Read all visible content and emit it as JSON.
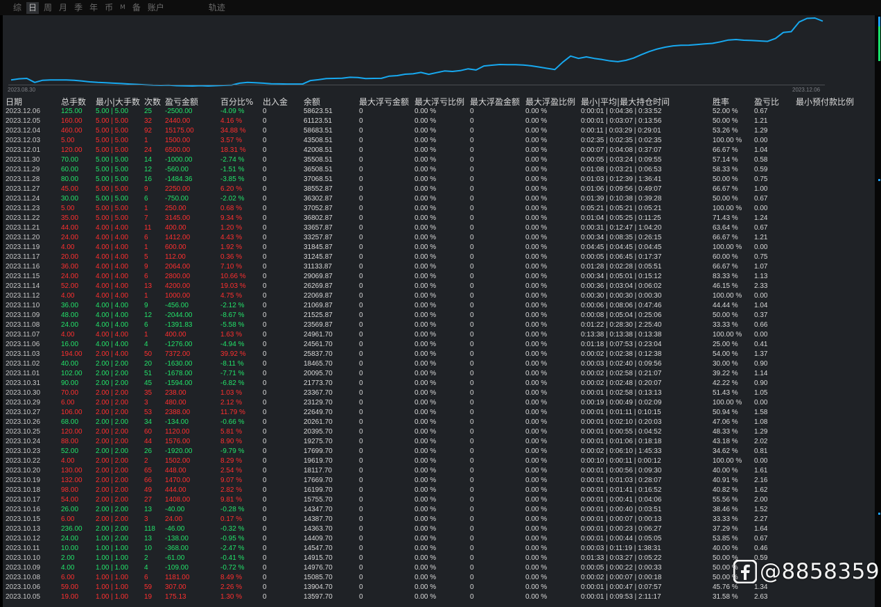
{
  "tabs": [
    {
      "label": "综",
      "active": false
    },
    {
      "label": "日",
      "active": true
    },
    {
      "label": "周",
      "active": false
    },
    {
      "label": "月",
      "active": false
    },
    {
      "label": "季",
      "active": false
    },
    {
      "label": "年",
      "active": false
    },
    {
      "label": "币",
      "active": false
    },
    {
      "label": "M",
      "active": false
    },
    {
      "label": "备",
      "active": false
    },
    {
      "label": "账户",
      "active": false
    },
    {
      "label": "轨迹",
      "active": false
    }
  ],
  "chart": {
    "start_label": "2023.08.30",
    "end_label": "2023.12.06",
    "line_color": "#17a9f0",
    "series": [
      13500,
      14150,
      14400,
      12000,
      13300,
      13500,
      13500,
      13500,
      13300,
      12800,
      12300,
      12000,
      11800,
      11500,
      11300,
      11000,
      10800,
      10500,
      10300,
      10200,
      10300,
      10000,
      9900,
      9800,
      10000,
      9800,
      10000,
      10200,
      10400,
      11500,
      12000,
      11800,
      11500,
      11200,
      11100,
      11000,
      11000,
      11000,
      13100,
      13600,
      14300,
      14400,
      14550,
      15100,
      14900,
      14350,
      14400,
      14450,
      15800,
      16100,
      16950,
      17200,
      18000,
      16900,
      17900,
      18900,
      18600,
      19100,
      20200,
      19500,
      21900,
      22400,
      22800,
      22700,
      22700,
      22500,
      22000,
      21300,
      20500,
      19800,
      24200,
      27900,
      26500,
      27400,
      26500,
      25800,
      25000,
      24500,
      25300,
      26700,
      28800,
      30700,
      32200,
      33300,
      34100,
      34400,
      34500,
      34900,
      35300,
      35600,
      36500,
      37600,
      37900,
      37500,
      37300,
      37050,
      36800,
      38550,
      42200,
      42700,
      48500,
      50700,
      50900,
      49000
    ]
  },
  "headers": {
    "date": "日期",
    "total": "总手数",
    "minmax": "最小|大手数",
    "count": "次数",
    "pl": "盈亏金额",
    "pct": "百分比%",
    "io": "出入金",
    "balance": "余额",
    "fl_amt": "最大浮亏金额",
    "fl_ratio": "最大浮亏比例",
    "fp_amt": "最大浮盈金额",
    "fp_ratio": "最大浮盈比例",
    "hold": "最小|平均|最大持仓时间",
    "win": "胜率",
    "ratio": "盈亏比",
    "min_prepay": "最小预付款比例"
  },
  "rows": [
    [
      "2023.12.06",
      "125.00",
      "5.00 | 5.00",
      "25",
      "-2500.00",
      "-4.09 %",
      "0",
      "58623.51",
      "0",
      "0.00 %",
      "0",
      "0.00 %",
      "0:00:01 | 0:04:36 | 0:33:52",
      "52.00 %",
      "0.67"
    ],
    [
      "2023.12.05",
      "160.00",
      "5.00 | 5.00",
      "32",
      "2440.00",
      "4.16 %",
      "0",
      "61123.51",
      "0",
      "0.00 %",
      "0",
      "0.00 %",
      "0:00:01 | 0:03:07 | 0:13:56",
      "50.00 %",
      "1.21"
    ],
    [
      "2023.12.04",
      "460.00",
      "5.00 | 5.00",
      "92",
      "15175.00",
      "34.88 %",
      "0",
      "58683.51",
      "0",
      "0.00 %",
      "0",
      "0.00 %",
      "0:00:11 | 0:03:29 | 0:29:01",
      "53.26 %",
      "1.29"
    ],
    [
      "2023.12.03",
      "5.00",
      "5.00 | 5.00",
      "1",
      "1500.00",
      "3.57 %",
      "0",
      "43508.51",
      "0",
      "0.00 %",
      "0",
      "0.00 %",
      "0:02:35 | 0:02:35 | 0:02:35",
      "100.00 %",
      "0.00"
    ],
    [
      "2023.12.01",
      "120.00",
      "5.00 | 5.00",
      "24",
      "6500.00",
      "18.31 %",
      "0",
      "42008.51",
      "0",
      "0.00 %",
      "0",
      "0.00 %",
      "0:00:07 | 0:04:08 | 0:37:07",
      "66.67 %",
      "1.04"
    ],
    [
      "2023.11.30",
      "70.00",
      "5.00 | 5.00",
      "14",
      "-1000.00",
      "-2.74 %",
      "0",
      "35508.51",
      "0",
      "0.00 %",
      "0",
      "0.00 %",
      "0:00:05 | 0:03:24 | 0:09:55",
      "57.14 %",
      "0.58"
    ],
    [
      "2023.11.29",
      "60.00",
      "5.00 | 5.00",
      "12",
      "-560.00",
      "-1.51 %",
      "0",
      "36508.51",
      "0",
      "0.00 %",
      "0",
      "0.00 %",
      "0:01:08 | 0:03:21 | 0:06:53",
      "58.33 %",
      "0.59"
    ],
    [
      "2023.11.28",
      "80.00",
      "5.00 | 5.00",
      "16",
      "-1484.36",
      "-3.85 %",
      "0",
      "37068.51",
      "0",
      "0.00 %",
      "0",
      "0.00 %",
      "0:01:03 | 0:12:39 | 1:36:41",
      "50.00 %",
      "0.75"
    ],
    [
      "2023.11.27",
      "45.00",
      "5.00 | 5.00",
      "9",
      "2250.00",
      "6.20 %",
      "0",
      "38552.87",
      "0",
      "0.00 %",
      "0",
      "0.00 %",
      "0:01:06 | 0:09:56 | 0:49:07",
      "66.67 %",
      "1.00"
    ],
    [
      "2023.11.24",
      "30.00",
      "5.00 | 5.00",
      "6",
      "-750.00",
      "-2.02 %",
      "0",
      "36302.87",
      "0",
      "0.00 %",
      "0",
      "0.00 %",
      "0:01:39 | 0:10:38 | 0:39:28",
      "50.00 %",
      "0.67"
    ],
    [
      "2023.11.23",
      "5.00",
      "5.00 | 5.00",
      "1",
      "250.00",
      "0.68 %",
      "0",
      "37052.87",
      "0",
      "0.00 %",
      "0",
      "0.00 %",
      "0:05:21 | 0:05:21 | 0:05:21",
      "100.00 %",
      "0.00"
    ],
    [
      "2023.11.22",
      "35.00",
      "5.00 | 5.00",
      "7",
      "3145.00",
      "9.34 %",
      "0",
      "36802.87",
      "0",
      "0.00 %",
      "0",
      "0.00 %",
      "0:01:04 | 0:05:25 | 0:11:25",
      "71.43 %",
      "1.24"
    ],
    [
      "2023.11.21",
      "44.00",
      "4.00 | 4.00",
      "11",
      "400.00",
      "1.20 %",
      "0",
      "33657.87",
      "0",
      "0.00 %",
      "0",
      "0.00 %",
      "0:00:31 | 0:12:47 | 1:04:20",
      "63.64 %",
      "0.67"
    ],
    [
      "2023.11.20",
      "24.00",
      "4.00 | 4.00",
      "6",
      "1412.00",
      "4.43 %",
      "0",
      "33257.87",
      "0",
      "0.00 %",
      "0",
      "0.00 %",
      "0:00:34 | 0:08:35 | 0:26:15",
      "66.67 %",
      "1.21"
    ],
    [
      "2023.11.19",
      "4.00",
      "4.00 | 4.00",
      "1",
      "600.00",
      "1.92 %",
      "0",
      "31845.87",
      "0",
      "0.00 %",
      "0",
      "0.00 %",
      "0:04:45 | 0:04:45 | 0:04:45",
      "100.00 %",
      "0.00"
    ],
    [
      "2023.11.17",
      "20.00",
      "4.00 | 4.00",
      "5",
      "112.00",
      "0.36 %",
      "0",
      "31245.87",
      "0",
      "0.00 %",
      "0",
      "0.00 %",
      "0:00:05 | 0:06:45 | 0:17:37",
      "60.00 %",
      "0.75"
    ],
    [
      "2023.11.16",
      "36.00",
      "4.00 | 4.00",
      "9",
      "2064.00",
      "7.10 %",
      "0",
      "31133.87",
      "0",
      "0.00 %",
      "0",
      "0.00 %",
      "0:01:28 | 0:02:28 | 0:05:51",
      "66.67 %",
      "1.07"
    ],
    [
      "2023.11.15",
      "24.00",
      "4.00 | 4.00",
      "6",
      "2800.00",
      "10.66 %",
      "0",
      "29069.87",
      "0",
      "0.00 %",
      "0",
      "0.00 %",
      "0:00:34 | 0:05:01 | 0:15:12",
      "83.33 %",
      "1.13"
    ],
    [
      "2023.11.14",
      "52.00",
      "4.00 | 4.00",
      "13",
      "4200.00",
      "19.03 %",
      "0",
      "26269.87",
      "0",
      "0.00 %",
      "0",
      "0.00 %",
      "0:00:36 | 0:03:04 | 0:06:02",
      "46.15 %",
      "2.33"
    ],
    [
      "2023.11.12",
      "4.00",
      "4.00 | 4.00",
      "1",
      "1000.00",
      "4.75 %",
      "0",
      "22069.87",
      "0",
      "0.00 %",
      "0",
      "0.00 %",
      "0:00:30 | 0:00:30 | 0:00:30",
      "100.00 %",
      "0.00"
    ],
    [
      "2023.11.10",
      "36.00",
      "4.00 | 4.00",
      "9",
      "-456.00",
      "-2.12 %",
      "0",
      "21069.87",
      "0",
      "0.00 %",
      "0",
      "0.00 %",
      "0:00:06 | 0:08:06 | 0:47:46",
      "44.44 %",
      "1.04"
    ],
    [
      "2023.11.09",
      "48.00",
      "4.00 | 4.00",
      "12",
      "-2044.00",
      "-8.67 %",
      "0",
      "21525.87",
      "0",
      "0.00 %",
      "0",
      "0.00 %",
      "0:00:08 | 0:05:04 | 0:25:06",
      "50.00 %",
      "0.37"
    ],
    [
      "2023.11.08",
      "24.00",
      "4.00 | 4.00",
      "6",
      "-1391.83",
      "-5.58 %",
      "0",
      "23569.87",
      "0",
      "0.00 %",
      "0",
      "0.00 %",
      "0:01:22 | 0:28:30 | 2:25:40",
      "33.33 %",
      "0.66"
    ],
    [
      "2023.11.07",
      "4.00",
      "4.00 | 4.00",
      "1",
      "400.00",
      "1.63 %",
      "0",
      "24961.70",
      "0",
      "0.00 %",
      "0",
      "0.00 %",
      "0:13:38 | 0:13:38 | 0:13:38",
      "100.00 %",
      "0.00"
    ],
    [
      "2023.11.06",
      "16.00",
      "4.00 | 4.00",
      "4",
      "-1276.00",
      "-4.94 %",
      "0",
      "24561.70",
      "0",
      "0.00 %",
      "0",
      "0.00 %",
      "0:01:18 | 0:07:53 | 0:23:04",
      "25.00 %",
      "0.41"
    ],
    [
      "2023.11.03",
      "194.00",
      "2.00 | 4.00",
      "50",
      "7372.00",
      "39.92 %",
      "0",
      "25837.70",
      "0",
      "0.00 %",
      "0",
      "0.00 %",
      "0:00:02 | 0:02:38 | 0:12:38",
      "54.00 %",
      "1.37"
    ],
    [
      "2023.11.02",
      "40.00",
      "2.00 | 2.00",
      "20",
      "-1630.00",
      "-8.11 %",
      "0",
      "18465.70",
      "0",
      "0.00 %",
      "0",
      "0.00 %",
      "0:00:03 | 0:02:40 | 0:09:56",
      "30.00 %",
      "0.90"
    ],
    [
      "2023.11.01",
      "102.00",
      "2.00 | 2.00",
      "51",
      "-1678.00",
      "-7.71 %",
      "0",
      "20095.70",
      "0",
      "0.00 %",
      "0",
      "0.00 %",
      "0:00:02 | 0:02:58 | 0:21:07",
      "39.22 %",
      "1.14"
    ],
    [
      "2023.10.31",
      "90.00",
      "2.00 | 2.00",
      "45",
      "-1594.00",
      "-6.82 %",
      "0",
      "21773.70",
      "0",
      "0.00 %",
      "0",
      "0.00 %",
      "0:00:02 | 0:02:48 | 0:20:07",
      "42.22 %",
      "0.90"
    ],
    [
      "2023.10.30",
      "70.00",
      "2.00 | 2.00",
      "35",
      "238.00",
      "1.03 %",
      "0",
      "23367.70",
      "0",
      "0.00 %",
      "0",
      "0.00 %",
      "0:00:01 | 0:02:58 | 0:13:13",
      "51.43 %",
      "1.05"
    ],
    [
      "2023.10.29",
      "6.00",
      "2.00 | 2.00",
      "3",
      "480.00",
      "2.12 %",
      "0",
      "23129.70",
      "0",
      "0.00 %",
      "0",
      "0.00 %",
      "0:00:19 | 0:00:49 | 0:02:09",
      "100.00 %",
      "0.00"
    ],
    [
      "2023.10.27",
      "106.00",
      "2.00 | 2.00",
      "53",
      "2388.00",
      "11.79 %",
      "0",
      "22649.70",
      "0",
      "0.00 %",
      "0",
      "0.00 %",
      "0:00:01 | 0:01:11 | 0:10:15",
      "50.94 %",
      "1.58"
    ],
    [
      "2023.10.26",
      "68.00",
      "2.00 | 2.00",
      "34",
      "-134.00",
      "-0.66 %",
      "0",
      "20261.70",
      "0",
      "0.00 %",
      "0",
      "0.00 %",
      "0:00:01 | 0:02:10 | 0:20:03",
      "47.06 %",
      "1.08"
    ],
    [
      "2023.10.25",
      "120.00",
      "2.00 | 2.00",
      "60",
      "1120.00",
      "5.81 %",
      "0",
      "20395.70",
      "0",
      "0.00 %",
      "0",
      "0.00 %",
      "0:00:01 | 0:00:55 | 0:04:52",
      "48.33 %",
      "1.29"
    ],
    [
      "2023.10.24",
      "88.00",
      "2.00 | 2.00",
      "44",
      "1576.00",
      "8.90 %",
      "0",
      "19275.70",
      "0",
      "0.00 %",
      "0",
      "0.00 %",
      "0:00:01 | 0:01:06 | 0:18:18",
      "43.18 %",
      "2.02"
    ],
    [
      "2023.10.23",
      "52.00",
      "2.00 | 2.00",
      "26",
      "-1920.00",
      "-9.79 %",
      "0",
      "17699.70",
      "0",
      "0.00 %",
      "0",
      "0.00 %",
      "0:00:02 | 0:06:10 | 1:45:33",
      "34.62 %",
      "0.81"
    ],
    [
      "2023.10.22",
      "4.00",
      "2.00 | 2.00",
      "2",
      "1502.00",
      "8.29 %",
      "0",
      "19619.70",
      "0",
      "0.00 %",
      "0",
      "0.00 %",
      "0:00:10 | 0:00:11 | 0:00:12",
      "100.00 %",
      "0.00"
    ],
    [
      "2023.10.20",
      "130.00",
      "2.00 | 2.00",
      "65",
      "448.00",
      "2.54 %",
      "0",
      "18117.70",
      "0",
      "0.00 %",
      "0",
      "0.00 %",
      "0:00:01 | 0:00:56 | 0:09:30",
      "40.00 %",
      "1.61"
    ],
    [
      "2023.10.19",
      "132.00",
      "2.00 | 2.00",
      "66",
      "1470.00",
      "9.07 %",
      "0",
      "17669.70",
      "0",
      "0.00 %",
      "0",
      "0.00 %",
      "0:00:01 | 0:01:03 | 0:28:07",
      "40.91 %",
      "2.16"
    ],
    [
      "2023.10.18",
      "98.00",
      "2.00 | 2.00",
      "49",
      "444.00",
      "2.82 %",
      "0",
      "16199.70",
      "0",
      "0.00 %",
      "0",
      "0.00 %",
      "0:00:01 | 0:01:41 | 0:16:52",
      "40.82 %",
      "1.62"
    ],
    [
      "2023.10.17",
      "54.00",
      "2.00 | 2.00",
      "27",
      "1408.00",
      "9.81 %",
      "0",
      "15755.70",
      "0",
      "0.00 %",
      "0",
      "0.00 %",
      "0:00:01 | 0:00:41 | 0:04:06",
      "55.56 %",
      "2.00"
    ],
    [
      "2023.10.16",
      "26.00",
      "2.00 | 2.00",
      "13",
      "-40.00",
      "-0.28 %",
      "0",
      "14347.70",
      "0",
      "0.00 %",
      "0",
      "0.00 %",
      "0:00:01 | 0:00:40 | 0:03:51",
      "38.46 %",
      "1.52"
    ],
    [
      "2023.10.15",
      "6.00",
      "2.00 | 2.00",
      "3",
      "24.00",
      "0.17 %",
      "0",
      "14387.70",
      "0",
      "0.00 %",
      "0",
      "0.00 %",
      "0:00:01 | 0:00:07 | 0:00:13",
      "33.33 %",
      "2.27"
    ],
    [
      "2023.10.13",
      "236.00",
      "2.00 | 2.00",
      "118",
      "-46.00",
      "-0.32 %",
      "0",
      "14363.70",
      "0",
      "0.00 %",
      "0",
      "0.00 %",
      "0:00:01 | 0:00:23 | 0:06:27",
      "37.29 %",
      "1.64"
    ],
    [
      "2023.10.12",
      "24.00",
      "1.00 | 2.00",
      "13",
      "-138.00",
      "-0.95 %",
      "0",
      "14409.70",
      "0",
      "0.00 %",
      "0",
      "0.00 %",
      "0:00:01 | 0:00:44 | 0:05:05",
      "53.85 %",
      "0.67"
    ],
    [
      "2023.10.11",
      "10.00",
      "1.00 | 1.00",
      "10",
      "-368.00",
      "-2.47 %",
      "0",
      "14547.70",
      "0",
      "0.00 %",
      "0",
      "0.00 %",
      "0:00:03 | 0:11:19 | 1:38:31",
      "40.00 %",
      "0.46"
    ],
    [
      "2023.10.10",
      "2.00",
      "1.00 | 1.00",
      "2",
      "-61.00",
      "-0.41 %",
      "0",
      "14915.70",
      "0",
      "0.00 %",
      "0",
      "0.00 %",
      "0:01:33 | 0:03:27 | 0:05:22",
      "50.00 %",
      "0.59"
    ],
    [
      "2023.10.09",
      "4.00",
      "1.00 | 1.00",
      "4",
      "-109.00",
      "-0.72 %",
      "0",
      "14976.70",
      "0",
      "0.00 %",
      "0",
      "0.00 %",
      "0:00:05 | 0:00:22 | 0:00:33",
      "50.00 %",
      ""
    ],
    [
      "2023.10.08",
      "6.00",
      "1.00 | 1.00",
      "6",
      "1181.00",
      "8.49 %",
      "0",
      "15085.70",
      "0",
      "0.00 %",
      "0",
      "0.00 %",
      "0:00:02 | 0:00:07 | 0:00:18",
      "50.00 %",
      ""
    ],
    [
      "2023.10.06",
      "59.00",
      "1.00 | 1.00",
      "59",
      "307.00",
      "2.26 %",
      "0",
      "13904.70",
      "0",
      "0.00 %",
      "0",
      "0.00 %",
      "0:00:01 | 0:00:47 | 0:07:57",
      "45.76 %",
      "1.34"
    ],
    [
      "2023.10.05",
      "19.00",
      "1.00 | 1.00",
      "19",
      "175.13",
      "1.30 %",
      "0",
      "13597.70",
      "0",
      "0.00 %",
      "0",
      "0.00 %",
      "0:00:01 | 0:09:53 | 2:11:17",
      "31.58 %",
      "2.63"
    ]
  ],
  "colors": {
    "profit": "#ff2f2f",
    "loss": "#22e36a",
    "background": "#1f2226"
  },
  "watermark": {
    "text": "@8858359",
    "icon": "facebook-icon"
  }
}
